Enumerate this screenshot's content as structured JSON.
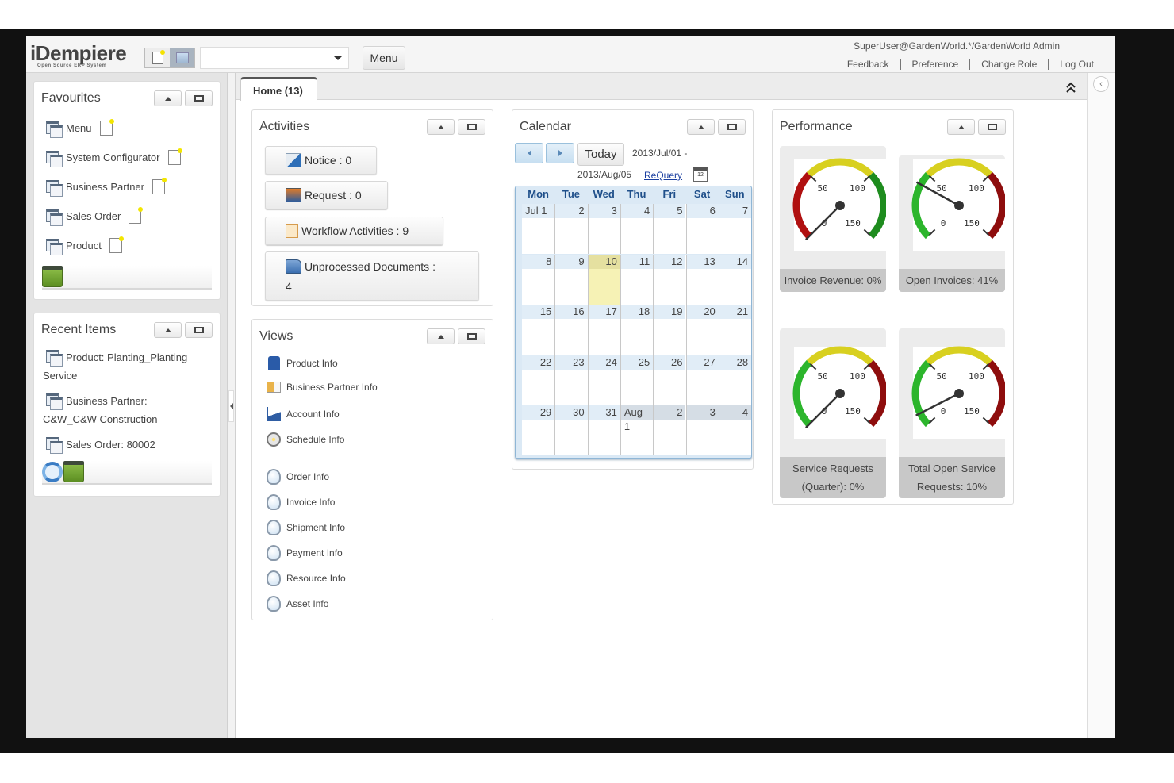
{
  "app": {
    "logo_text": "iDempiere",
    "logo_subtitle": "Open Source ERP System",
    "search_placeholder": "",
    "menu_button": "Menu",
    "user": "SuperUser@GardenWorld.*/GardenWorld Admin",
    "links": [
      "Feedback",
      "Preference",
      "Change Role",
      "Log Out"
    ]
  },
  "favourites": {
    "title": "Favourites",
    "items": [
      "Menu",
      "System Configurator",
      "Business Partner",
      "Sales Order",
      "Product"
    ]
  },
  "recent": {
    "title": "Recent Items",
    "items": [
      "Product: Planting_Planting Service",
      "Business Partner: C&W_C&W Construction",
      "Sales Order: 80002"
    ]
  },
  "tabs": [
    {
      "label": "Home (13)",
      "active": true
    }
  ],
  "activities": {
    "title": "Activities",
    "items": [
      {
        "label": "Notice : 0",
        "icon": "notice-icon"
      },
      {
        "label": "Request : 0",
        "icon": "request-icon"
      },
      {
        "label": "Workflow Activities : 9",
        "icon": "workflow-icon"
      },
      {
        "label": "Unprocessed Documents :",
        "value": "4",
        "icon": "folder-icon"
      }
    ]
  },
  "views": {
    "title": "Views",
    "items": [
      {
        "label": "Product Info",
        "icon": "product-icon"
      },
      {
        "label": "Business Partner Info",
        "icon": "business-partner-icon"
      },
      {
        "label": "Account Info",
        "icon": "account-chart-icon"
      },
      {
        "label": "Schedule Info",
        "icon": "schedule-icon"
      },
      {
        "label": "Order Info",
        "icon": "lightbulb-icon"
      },
      {
        "label": "Invoice Info",
        "icon": "lightbulb-icon"
      },
      {
        "label": "Shipment Info",
        "icon": "lightbulb-icon"
      },
      {
        "label": "Payment Info",
        "icon": "lightbulb-icon"
      },
      {
        "label": "Resource Info",
        "icon": "lightbulb-icon"
      },
      {
        "label": "Asset Info",
        "icon": "lightbulb-icon"
      }
    ]
  },
  "calendar": {
    "title": "Calendar",
    "today_label": "Today",
    "range_start": "2013/Jul/01 -",
    "range_end": "2013/Aug/05",
    "requery_label": "ReQuery",
    "cal_icon_text": "12",
    "weekdays": [
      "Mon",
      "Tue",
      "Wed",
      "Thu",
      "Fri",
      "Sat",
      "Sun"
    ],
    "today": "10",
    "weeks": [
      [
        "Jul 1",
        "2",
        "3",
        "4",
        "5",
        "6",
        "7"
      ],
      [
        "8",
        "9",
        "10",
        "11",
        "12",
        "13",
        "14"
      ],
      [
        "15",
        "16",
        "17",
        "18",
        "19",
        "20",
        "21"
      ],
      [
        "22",
        "23",
        "24",
        "25",
        "26",
        "27",
        "28"
      ],
      [
        "29",
        "30",
        "31",
        "Aug 1",
        "2",
        "3",
        "4"
      ]
    ]
  },
  "performance": {
    "title": "Performance",
    "scale_ticks": [
      "0",
      "50",
      "100",
      "150"
    ],
    "gauges": [
      {
        "label": "Invoice Revenue: 0%",
        "value_percent": 0,
        "zones": [
          "#b01010",
          "#d8d020",
          "#1e8c1e"
        ]
      },
      {
        "label": "Open Invoices: 41%",
        "value_percent": 41,
        "zones": [
          "#2cb52c",
          "#d8d020",
          "#8e0d0d"
        ]
      },
      {
        "label": "Service Requests (Quarter): 0%",
        "value_percent": 0,
        "zones": [
          "#2cb52c",
          "#d8d020",
          "#8e0d0d"
        ]
      },
      {
        "label": "Total Open Service Requests: 10%",
        "value_percent": 10,
        "zones": [
          "#2cb52c",
          "#d8d020",
          "#8e0d0d"
        ]
      }
    ]
  },
  "colors": {
    "frame": "#111111",
    "sidebar": "#e4e4e4",
    "calendar_header_text": "#1f4f8a",
    "today_highlight": "#f6f2b5",
    "link": "#1b3fa0"
  }
}
